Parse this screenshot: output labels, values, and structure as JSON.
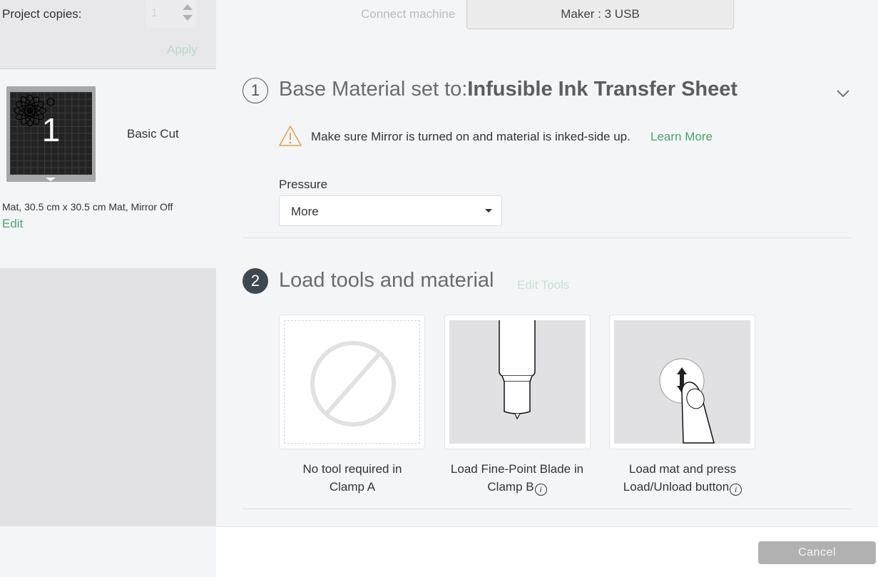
{
  "sidebar": {
    "copies_label": "Project copies:",
    "copies_value": "1",
    "apply_label": "Apply",
    "mat": {
      "number": "1",
      "name": "Basic Cut",
      "description": "Mat, 30.5 cm x 30.5 cm Mat, Mirror Off",
      "edit_label": "Edit"
    }
  },
  "header": {
    "connect_label": "Connect machine",
    "machine_label": "Maker : 3 USB"
  },
  "step1": {
    "number": "1",
    "title_prefix": "Base Material set to:",
    "material": "Infusible Ink Transfer Sheet",
    "warning_text": "Make sure Mirror is turned on and material is inked-side up.",
    "learn_more_label": "Learn More",
    "pressure_label": "Pressure",
    "pressure_value": "More"
  },
  "step2": {
    "number": "2",
    "title": "Load tools and material",
    "edit_tools_label": "Edit Tools",
    "cards": [
      {
        "line1": "No tool required in",
        "line2": "Clamp A",
        "icon": "no-tool-icon"
      },
      {
        "line1": "Load Fine-Point Blade in",
        "line2": "Clamp B",
        "icon": "fine-point-blade-icon"
      },
      {
        "line1": "Load mat and press",
        "line2": "Load/Unload button",
        "icon": "load-unload-button-icon"
      }
    ],
    "info_glyph": "i"
  },
  "footer": {
    "cancel_label": "Cancel"
  },
  "colors": {
    "accent_green": "#4aa36d",
    "disabled_green": "#b6dcc6",
    "warning_orange": "#e0a050",
    "step_dark": "#3f4850"
  }
}
